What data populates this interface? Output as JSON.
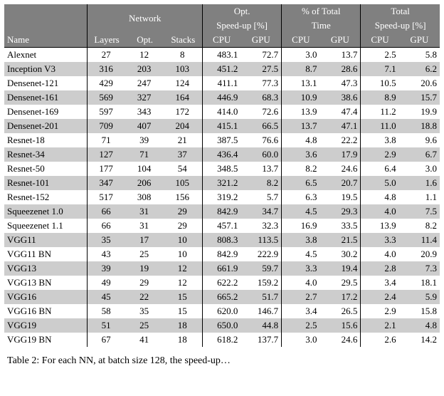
{
  "header": {
    "name": "Name",
    "network": "Network",
    "layers": "Layers",
    "opt": "Opt.",
    "stacks": "Stacks",
    "opt_speed": "Opt.",
    "opt_speed2": "Speed-up [%]",
    "pct_total": "% of Total",
    "pct_time": "Time",
    "total": "Total",
    "total_speed": "Speed-up [%]",
    "cpu": "CPU",
    "gpu": "GPU"
  },
  "rows": [
    {
      "name": "Alexnet",
      "layers": "27",
      "opt": "12",
      "stacks": "8",
      "oc": "483.1",
      "og": "72.7",
      "pc": "3.0",
      "pg": "13.7",
      "tc": "2.5",
      "tg": "5.8"
    },
    {
      "name": "Inception V3",
      "layers": "316",
      "opt": "203",
      "stacks": "103",
      "oc": "451.2",
      "og": "27.5",
      "pc": "8.7",
      "pg": "28.6",
      "tc": "7.1",
      "tg": "6.2"
    },
    {
      "name": "Densenet-121",
      "layers": "429",
      "opt": "247",
      "stacks": "124",
      "oc": "411.1",
      "og": "77.3",
      "pc": "13.1",
      "pg": "47.3",
      "tc": "10.5",
      "tg": "20.6"
    },
    {
      "name": "Densenet-161",
      "layers": "569",
      "opt": "327",
      "stacks": "164",
      "oc": "446.9",
      "og": "68.3",
      "pc": "10.9",
      "pg": "38.6",
      "tc": "8.9",
      "tg": "15.7"
    },
    {
      "name": "Densenet-169",
      "layers": "597",
      "opt": "343",
      "stacks": "172",
      "oc": "414.0",
      "og": "72.6",
      "pc": "13.9",
      "pg": "47.4",
      "tc": "11.2",
      "tg": "19.9"
    },
    {
      "name": "Densenet-201",
      "layers": "709",
      "opt": "407",
      "stacks": "204",
      "oc": "415.1",
      "og": "66.5",
      "pc": "13.7",
      "pg": "47.1",
      "tc": "11.0",
      "tg": "18.8"
    },
    {
      "name": "Resnet-18",
      "layers": "71",
      "opt": "39",
      "stacks": "21",
      "oc": "387.5",
      "og": "76.6",
      "pc": "4.8",
      "pg": "22.2",
      "tc": "3.8",
      "tg": "9.6"
    },
    {
      "name": "Resnet-34",
      "layers": "127",
      "opt": "71",
      "stacks": "37",
      "oc": "436.4",
      "og": "60.0",
      "pc": "3.6",
      "pg": "17.9",
      "tc": "2.9",
      "tg": "6.7"
    },
    {
      "name": "Resnet-50",
      "layers": "177",
      "opt": "104",
      "stacks": "54",
      "oc": "348.5",
      "og": "13.7",
      "pc": "8.2",
      "pg": "24.6",
      "tc": "6.4",
      "tg": "3.0"
    },
    {
      "name": "Resnet-101",
      "layers": "347",
      "opt": "206",
      "stacks": "105",
      "oc": "321.2",
      "og": "8.2",
      "pc": "6.5",
      "pg": "20.7",
      "tc": "5.0",
      "tg": "1.6"
    },
    {
      "name": "Resnet-152",
      "layers": "517",
      "opt": "308",
      "stacks": "156",
      "oc": "319.2",
      "og": "5.7",
      "pc": "6.3",
      "pg": "19.5",
      "tc": "4.8",
      "tg": "1.1"
    },
    {
      "name": "Squeezenet 1.0",
      "layers": "66",
      "opt": "31",
      "stacks": "29",
      "oc": "842.9",
      "og": "34.7",
      "pc": "4.5",
      "pg": "29.3",
      "tc": "4.0",
      "tg": "7.5"
    },
    {
      "name": "Squeezenet 1.1",
      "layers": "66",
      "opt": "31",
      "stacks": "29",
      "oc": "457.1",
      "og": "32.3",
      "pc": "16.9",
      "pg": "33.5",
      "tc": "13.9",
      "tg": "8.2"
    },
    {
      "name": "VGG11",
      "layers": "35",
      "opt": "17",
      "stacks": "10",
      "oc": "808.3",
      "og": "113.5",
      "pc": "3.8",
      "pg": "21.5",
      "tc": "3.3",
      "tg": "11.4"
    },
    {
      "name": "VGG11 BN",
      "layers": "43",
      "opt": "25",
      "stacks": "10",
      "oc": "842.9",
      "og": "222.9",
      "pc": "4.5",
      "pg": "30.2",
      "tc": "4.0",
      "tg": "20.9"
    },
    {
      "name": "VGG13",
      "layers": "39",
      "opt": "19",
      "stacks": "12",
      "oc": "661.9",
      "og": "59.7",
      "pc": "3.3",
      "pg": "19.4",
      "tc": "2.8",
      "tg": "7.3"
    },
    {
      "name": "VGG13 BN",
      "layers": "49",
      "opt": "29",
      "stacks": "12",
      "oc": "622.2",
      "og": "159.2",
      "pc": "4.0",
      "pg": "29.5",
      "tc": "3.4",
      "tg": "18.1"
    },
    {
      "name": "VGG16",
      "layers": "45",
      "opt": "22",
      "stacks": "15",
      "oc": "665.2",
      "og": "51.7",
      "pc": "2.7",
      "pg": "17.2",
      "tc": "2.4",
      "tg": "5.9"
    },
    {
      "name": "VGG16 BN",
      "layers": "58",
      "opt": "35",
      "stacks": "15",
      "oc": "620.0",
      "og": "146.7",
      "pc": "3.4",
      "pg": "26.5",
      "tc": "2.9",
      "tg": "15.8"
    },
    {
      "name": "VGG19",
      "layers": "51",
      "opt": "25",
      "stacks": "18",
      "oc": "650.0",
      "og": "44.8",
      "pc": "2.5",
      "pg": "15.6",
      "tc": "2.1",
      "tg": "4.8"
    },
    {
      "name": "VGG19 BN",
      "layers": "67",
      "opt": "41",
      "stacks": "18",
      "oc": "618.2",
      "og": "137.7",
      "pc": "3.0",
      "pg": "24.6",
      "tc": "2.6",
      "tg": "14.2"
    }
  ],
  "caption_prefix": "Table 2: ",
  "caption_rest": "For each NN, at batch size 128, the speed-up…",
  "chart_data": {
    "type": "table",
    "title": "Table 2",
    "columns": [
      "Name",
      "Network Layers",
      "Network Opt.",
      "Network Stacks",
      "Opt. Speed-up [%] CPU",
      "Opt. Speed-up [%] GPU",
      "% of Total Time CPU",
      "% of Total Time GPU",
      "Total Speed-up [%] CPU",
      "Total Speed-up [%] GPU"
    ],
    "rows": [
      [
        "Alexnet",
        27,
        12,
        8,
        483.1,
        72.7,
        3.0,
        13.7,
        2.5,
        5.8
      ],
      [
        "Inception V3",
        316,
        203,
        103,
        451.2,
        27.5,
        8.7,
        28.6,
        7.1,
        6.2
      ],
      [
        "Densenet-121",
        429,
        247,
        124,
        411.1,
        77.3,
        13.1,
        47.3,
        10.5,
        20.6
      ],
      [
        "Densenet-161",
        569,
        327,
        164,
        446.9,
        68.3,
        10.9,
        38.6,
        8.9,
        15.7
      ],
      [
        "Densenet-169",
        597,
        343,
        172,
        414.0,
        72.6,
        13.9,
        47.4,
        11.2,
        19.9
      ],
      [
        "Densenet-201",
        709,
        407,
        204,
        415.1,
        66.5,
        13.7,
        47.1,
        11.0,
        18.8
      ],
      [
        "Resnet-18",
        71,
        39,
        21,
        387.5,
        76.6,
        4.8,
        22.2,
        3.8,
        9.6
      ],
      [
        "Resnet-34",
        127,
        71,
        37,
        436.4,
        60.0,
        3.6,
        17.9,
        2.9,
        6.7
      ],
      [
        "Resnet-50",
        177,
        104,
        54,
        348.5,
        13.7,
        8.2,
        24.6,
        6.4,
        3.0
      ],
      [
        "Resnet-101",
        347,
        206,
        105,
        321.2,
        8.2,
        6.5,
        20.7,
        5.0,
        1.6
      ],
      [
        "Resnet-152",
        517,
        308,
        156,
        319.2,
        5.7,
        6.3,
        19.5,
        4.8,
        1.1
      ],
      [
        "Squeezenet 1.0",
        66,
        31,
        29,
        842.9,
        34.7,
        4.5,
        29.3,
        4.0,
        7.5
      ],
      [
        "Squeezenet 1.1",
        66,
        31,
        29,
        457.1,
        32.3,
        16.9,
        33.5,
        13.9,
        8.2
      ],
      [
        "VGG11",
        35,
        17,
        10,
        808.3,
        113.5,
        3.8,
        21.5,
        3.3,
        11.4
      ],
      [
        "VGG11 BN",
        43,
        25,
        10,
        842.9,
        222.9,
        4.5,
        30.2,
        4.0,
        20.9
      ],
      [
        "VGG13",
        39,
        19,
        12,
        661.9,
        59.7,
        3.3,
        19.4,
        2.8,
        7.3
      ],
      [
        "VGG13 BN",
        49,
        29,
        12,
        622.2,
        159.2,
        4.0,
        29.5,
        3.4,
        18.1
      ],
      [
        "VGG16",
        45,
        22,
        15,
        665.2,
        51.7,
        2.7,
        17.2,
        2.4,
        5.9
      ],
      [
        "VGG16 BN",
        58,
        35,
        15,
        620.0,
        146.7,
        3.4,
        26.5,
        2.9,
        15.8
      ],
      [
        "VGG19",
        51,
        25,
        18,
        650.0,
        44.8,
        2.5,
        15.6,
        2.1,
        4.8
      ],
      [
        "VGG19 BN",
        67,
        41,
        18,
        618.2,
        137.7,
        3.0,
        24.6,
        2.6,
        14.2
      ]
    ]
  }
}
